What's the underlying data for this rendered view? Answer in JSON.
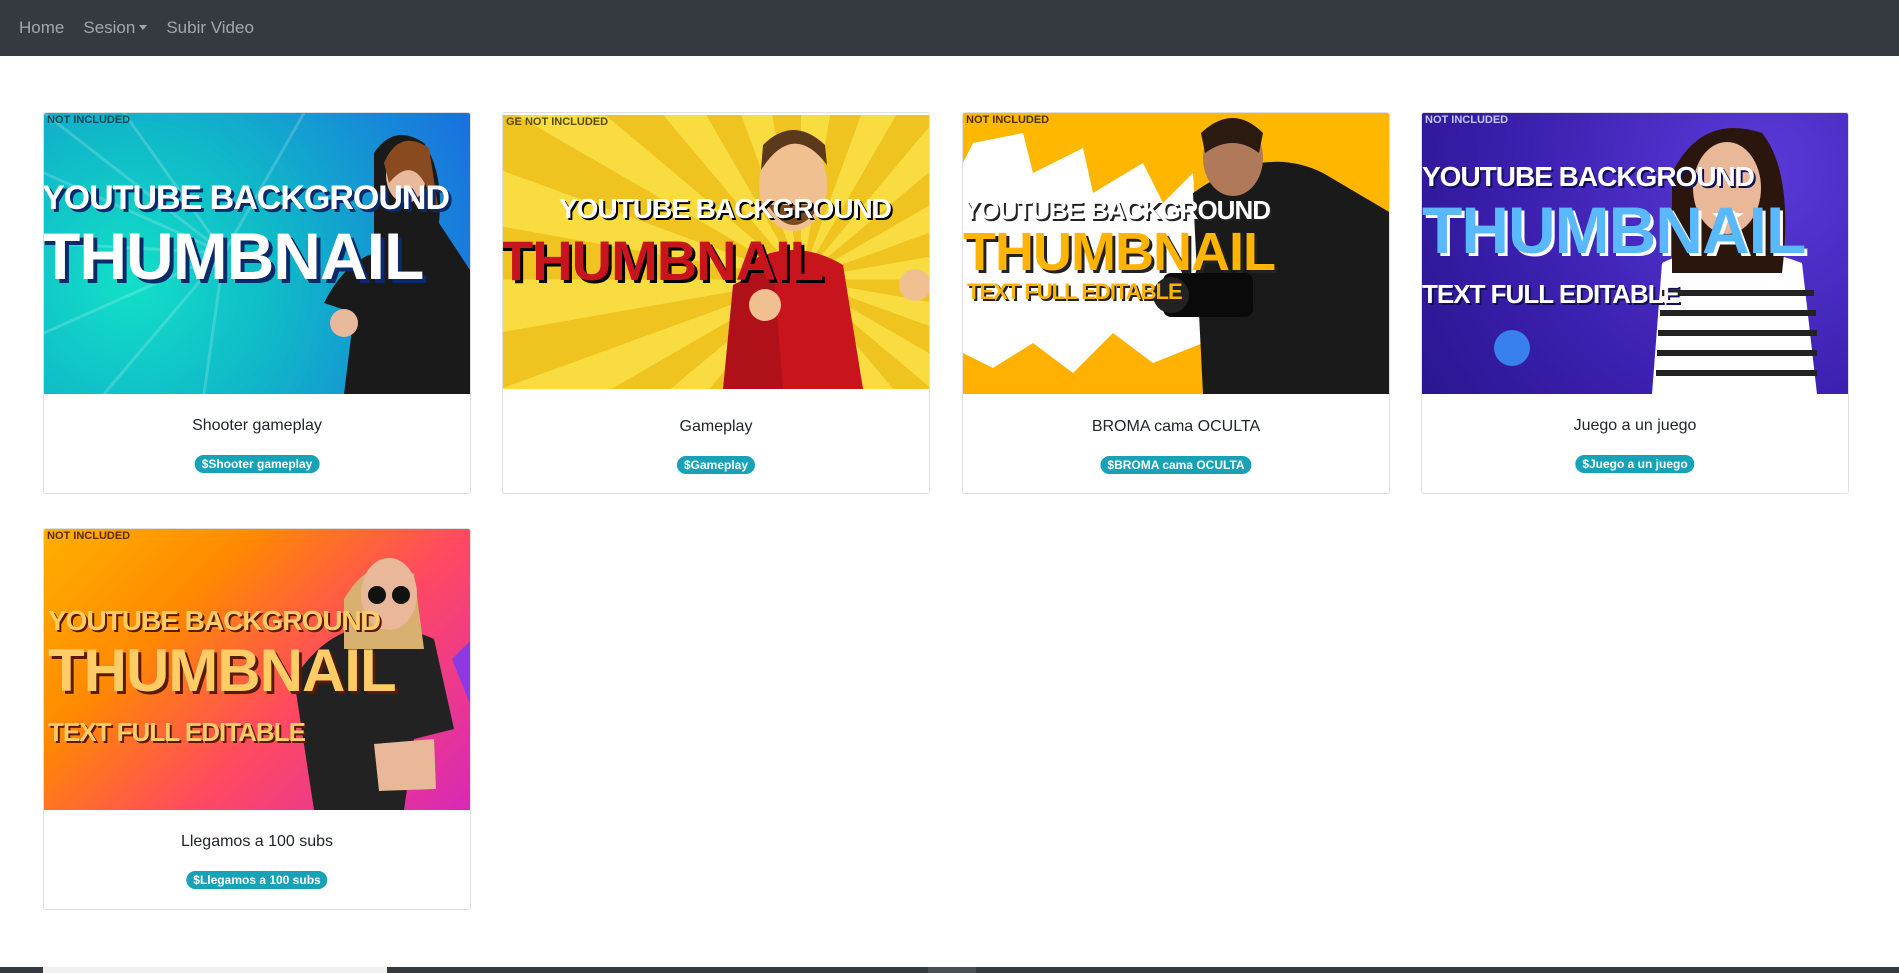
{
  "navbar": {
    "home": "Home",
    "sesion": "Sesion",
    "subir": "Subir Video"
  },
  "cards": [
    {
      "title": "Shooter gameplay",
      "badge": "$Shooter gameplay",
      "thumb": {
        "line1": "YOUTUBE BACKGROUND",
        "line2": "THUMBNAIL",
        "line3": "",
        "corner": "NOT INCLUDED",
        "colors": [
          "#12c7c0",
          "#1a6fe0"
        ]
      }
    },
    {
      "title": "Gameplay",
      "badge": "$Gameplay",
      "thumb": {
        "line1": "YOUTUBE BACKGROUND",
        "line2": "THUMBNAIL",
        "line3": "",
        "corner": "GE NOT INCLUDED",
        "colors": [
          "#f6d23a",
          "#f0b820"
        ]
      }
    },
    {
      "title": "BROMA cama OCULTA",
      "badge": "$BROMA cama OCULTA",
      "thumb": {
        "line1": "YOUTUBE BACKGROUND",
        "line2": "THUMBNAIL",
        "line3": "TEXT FULL EDITABLE",
        "corner": "NOT INCLUDED",
        "colors": [
          "#ffb400",
          "#ffffff"
        ]
      }
    },
    {
      "title": "Juego a un juego",
      "badge": "$Juego a un juego",
      "thumb": {
        "line1": "YOUTUBE BACKGROUND",
        "line2": "THUMBNAIL",
        "line3": "TEXT FULL EDITABLE",
        "corner": "NOT INCLUDED",
        "colors": [
          "#3b1fae",
          "#6a3ad8"
        ]
      }
    },
    {
      "title": "Llegamos a 100 subs",
      "badge": "$Llegamos a 100 subs",
      "thumb": {
        "line1": "YOUTUBE BACKGROUND",
        "line2": "THUMBNAIL",
        "line3": "TEXT FULL EDITABLE",
        "corner": "NOT INCLUDED",
        "colors": [
          "#ffb400",
          "#e6279a"
        ]
      }
    }
  ],
  "colors": {
    "navbar_bg": "#343a40",
    "badge_bg": "#17a2b8"
  }
}
